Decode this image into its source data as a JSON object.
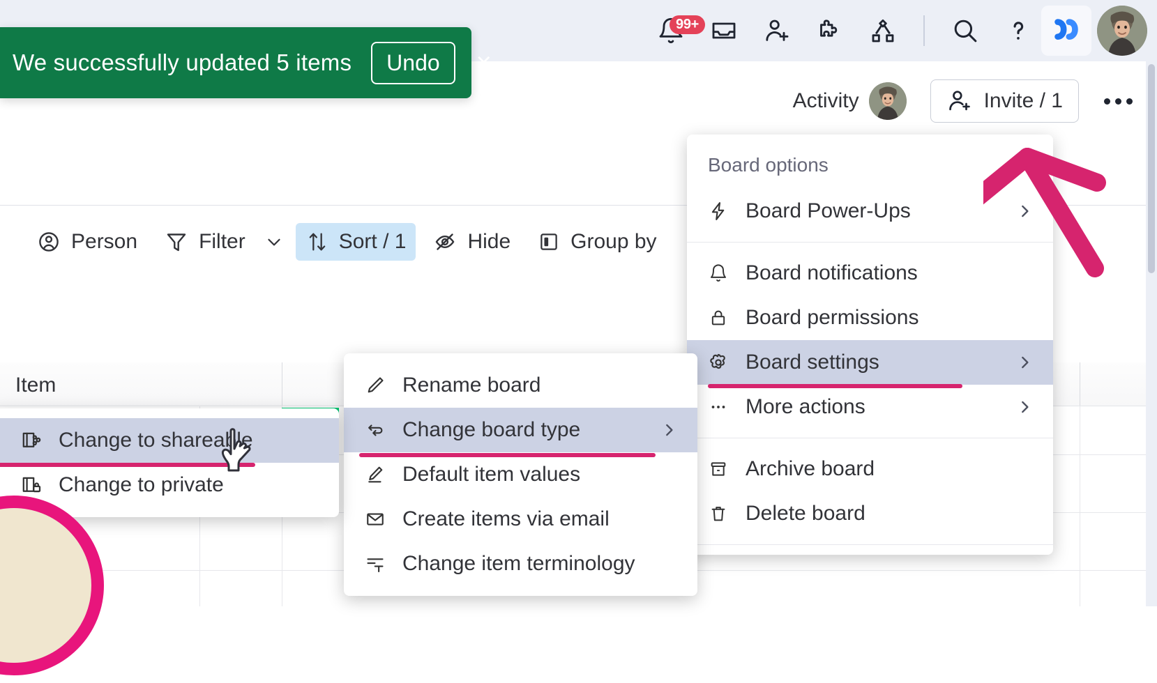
{
  "app": {
    "brand_accent": "#0073ea",
    "toast_green": "#0f7a47",
    "annotation_pink": "#d6246e",
    "highlight_blue": "#cce5f8",
    "menu_highlight": "#ccd2e4",
    "topbar_bg": "#eceff6"
  },
  "topbar": {
    "notifications_badge": "99+",
    "icons": [
      {
        "name": "bell-icon",
        "title": "Notifications"
      },
      {
        "name": "inbox-icon",
        "title": "Inbox"
      },
      {
        "name": "invite-members-icon",
        "title": "Invite members"
      },
      {
        "name": "apps-puzzle-icon",
        "title": "Apps"
      },
      {
        "name": "workflows-icon",
        "title": "Workflows"
      },
      {
        "name": "search-icon",
        "title": "Search"
      },
      {
        "name": "help-icon",
        "title": "Help"
      }
    ],
    "logo_name": "monday-logo",
    "account_avatar": "user-avatar"
  },
  "board_header": {
    "activity_label": "Activity",
    "activity_avatar": "activity-user-avatar",
    "invite_label": "Invite / 1",
    "kebab_label": "Board menu"
  },
  "toolbar": {
    "items": [
      {
        "label": "Person",
        "icon": "person-icon",
        "active": false
      },
      {
        "label": "Filter",
        "icon": "filter-icon",
        "active": false
      },
      {
        "label": "Sort / 1",
        "icon": "sort-icon",
        "active": true
      },
      {
        "label": "Hide",
        "icon": "hide-eye-icon",
        "active": false
      },
      {
        "label": "Group by",
        "icon": "group-by-icon",
        "active": false
      }
    ],
    "filter_chevron": "chevron-down-icon"
  },
  "toast": {
    "message": "We successfully updated 5 items",
    "undo_label": "Undo",
    "close_label": "×"
  },
  "grid": {
    "column_header": "Item"
  },
  "menus": {
    "board_options": {
      "title": "Board options",
      "groups": [
        {
          "items": [
            {
              "label": "Board Power-Ups",
              "icon": "power-up-bolt-icon",
              "chevron": true,
              "highlighted": false,
              "underlined": false
            }
          ]
        },
        {
          "items": [
            {
              "label": "Board notifications",
              "icon": "bell-icon",
              "chevron": false,
              "highlighted": false,
              "underlined": false
            },
            {
              "label": "Board permissions",
              "icon": "lock-icon",
              "chevron": false,
              "highlighted": false,
              "underlined": false
            },
            {
              "label": "Board settings",
              "icon": "gear-icon",
              "chevron": true,
              "highlighted": true,
              "underlined": true
            },
            {
              "label": "More actions",
              "icon": "ellipsis-icon",
              "chevron": true,
              "highlighted": false,
              "underlined": false
            }
          ]
        },
        {
          "items": [
            {
              "label": "Archive board",
              "icon": "archive-icon",
              "chevron": false,
              "highlighted": false,
              "underlined": false
            },
            {
              "label": "Delete board",
              "icon": "trash-icon",
              "chevron": false,
              "highlighted": false,
              "underlined": false
            }
          ]
        }
      ]
    },
    "board_settings": {
      "items": [
        {
          "label": "Rename board",
          "icon": "pencil-icon",
          "chevron": false,
          "highlighted": false,
          "underlined": false
        },
        {
          "label": "Change board type",
          "icon": "swap-arrows-icon",
          "chevron": true,
          "highlighted": true,
          "underlined": true
        },
        {
          "label": "Default item values",
          "icon": "edit-square-icon",
          "chevron": false,
          "highlighted": false,
          "underlined": false
        },
        {
          "label": "Create items via email",
          "icon": "envelope-icon",
          "chevron": false,
          "highlighted": false,
          "underlined": false
        },
        {
          "label": "Change item terminology",
          "icon": "text-format-icon",
          "chevron": false,
          "highlighted": false,
          "underlined": false
        }
      ]
    },
    "board_type": {
      "items": [
        {
          "label": "Change to shareable",
          "icon": "board-share-icon",
          "chevron": false,
          "highlighted": true,
          "underlined": true
        },
        {
          "label": "Change to private",
          "icon": "board-lock-icon",
          "chevron": false,
          "highlighted": false,
          "underlined": false
        }
      ]
    }
  },
  "annotations": {
    "arrow": {
      "name": "pink-arrow-pointing-to-board-menu",
      "color": "#d6246e"
    },
    "circle": {
      "name": "pink-circle-highlight",
      "color": "#d6246e"
    },
    "cursor": {
      "name": "hand-cursor"
    }
  }
}
